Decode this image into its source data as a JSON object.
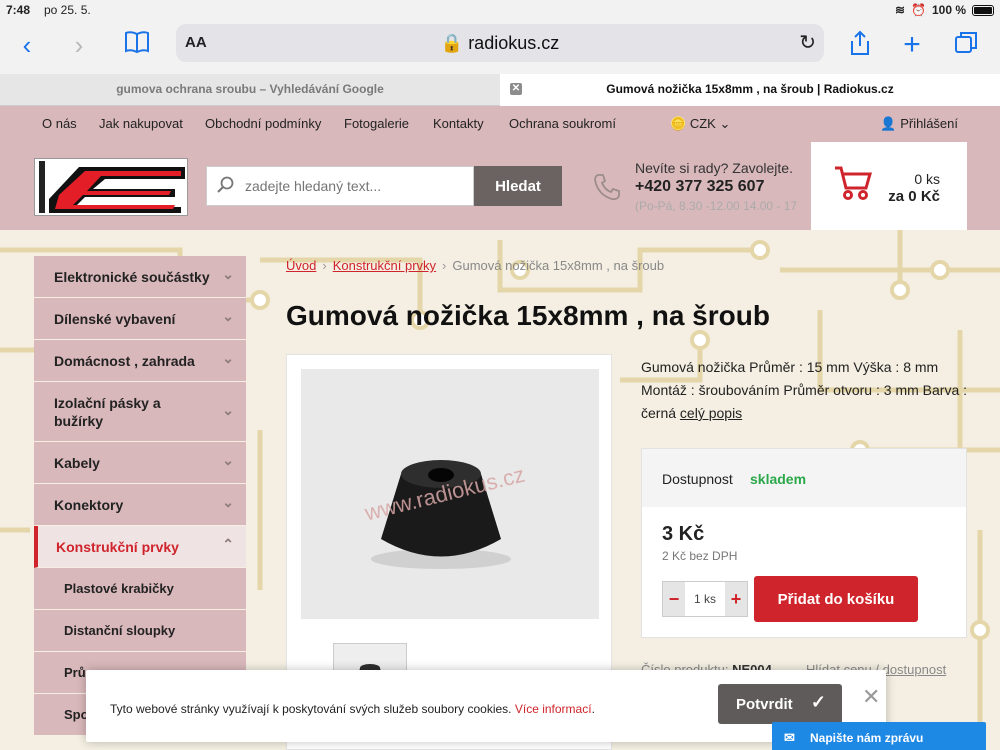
{
  "status": {
    "time": "7:48",
    "date": "po 25. 5.",
    "battery": "100 %"
  },
  "browser": {
    "text_size": "AA",
    "url": "radiokus.cz",
    "tabs": [
      {
        "title": "gumova ochrana sroubu – Vyhledávání Google"
      },
      {
        "title": "Gumová nožička 15x8mm , na šroub | Radiokus.cz"
      }
    ]
  },
  "topnav": {
    "items": [
      "O nás",
      "Jak nakupovat",
      "Obchodní podmínky",
      "Fotogalerie",
      "Kontakty",
      "Ochrana soukromí"
    ],
    "currency": "CZK",
    "login": "Přihlášení"
  },
  "header": {
    "search_placeholder": "zadejte hledaný text...",
    "search_button": "Hledat",
    "contact_question": "Nevíte si rady? Zavolejte.",
    "phone": "+420 377 325 607",
    "hours": "(Po-Pá, 8.30 -12.00 14.00 - 17",
    "cart_count": "0 ks",
    "cart_sum": "za 0 Kč"
  },
  "sidebar": {
    "categories": [
      "Elektronické součástky",
      "Dílenské vybavení",
      "Domácnost , zahrada",
      "Izolační pásky a bužírky",
      "Kabely",
      "Konektory",
      "Konstrukční prvky"
    ],
    "subcategories": [
      "Plastové krabičky",
      "Distanční sloupky",
      "Prů",
      "Spo"
    ]
  },
  "breadcrumb": {
    "home": "Úvod",
    "parent": "Konstrukční prvky",
    "current": "Gumová nožička 15x8mm , na šroub"
  },
  "product": {
    "title": "Gumová nožička 15x8mm , na šroub",
    "watermark": "www.radiokus.cz",
    "description": "Gumová nožička  Průměr : 15 mm Výška : 8 mm Montáž : šroubováním Průměr otvoru : 3 mm Barva : černá",
    "more_link": "celý popis",
    "availability_label": "Dostupnost",
    "availability_value": "skladem",
    "price": "3 Kč",
    "price_net": "2 Kč bez DPH",
    "qty_value": "1 ks",
    "add_button": "Přidat do košíku",
    "code_label": "Číslo produktu:",
    "code_value": "NE004",
    "watch_link": "Hlídat cenu / dostupnost"
  },
  "cookie": {
    "text": "Tyto webové stránky využívají k poskytování svých služeb soubory cookies.",
    "link": "Více informací",
    "confirm": "Potvrdit"
  },
  "chat": {
    "label": "Napište nám zprávu"
  },
  "colors": {
    "brand_red": "#d0242c",
    "header_pink": "#d9b8bb",
    "stock_green": "#2aa84a"
  }
}
